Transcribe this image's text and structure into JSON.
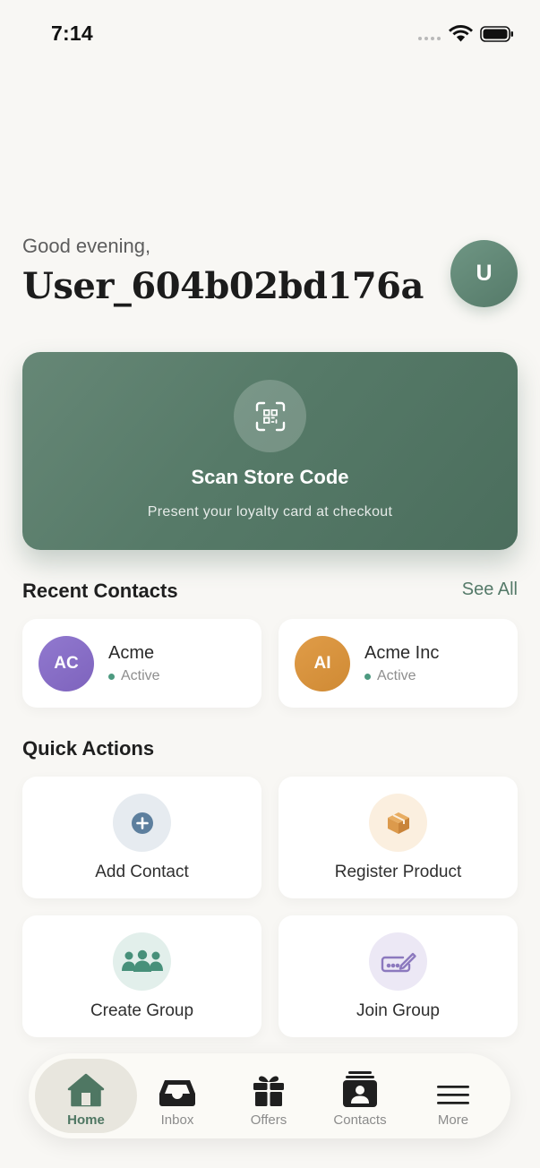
{
  "status_bar": {
    "time": "7:14"
  },
  "header": {
    "greeting": "Good evening,",
    "username": "User_604b02bd176a",
    "avatar_initial": "U"
  },
  "scan_card": {
    "title": "Scan Store Code",
    "subtitle": "Present your loyalty card at checkout",
    "icon": "qr-scan-icon"
  },
  "recent_contacts": {
    "title": "Recent Contacts",
    "see_all": "See All",
    "items": [
      {
        "initials": "AC",
        "name": "Acme",
        "status": "Active",
        "color": "#8c6dc6"
      },
      {
        "initials": "AI",
        "name": "Acme Inc",
        "status": "Active",
        "color": "#d9913a"
      }
    ]
  },
  "quick_actions": {
    "title": "Quick Actions",
    "items": [
      {
        "label": "Add Contact",
        "icon": "plus-circle-icon",
        "bg": "#e6ebf0",
        "color": "#5d7f9e"
      },
      {
        "label": "Register Product",
        "icon": "box-icon",
        "bg": "#fbefdf",
        "color": "#dc9a4c"
      },
      {
        "label": "Create Group",
        "icon": "group-icon",
        "bg": "#e2efeb",
        "color": "#47907a"
      },
      {
        "label": "Join Group",
        "icon": "ticket-pen-icon",
        "bg": "#ece8f5",
        "color": "#8c79be"
      }
    ]
  },
  "tab_bar": {
    "active": "Home",
    "items": [
      {
        "label": "Home",
        "icon": "home-icon"
      },
      {
        "label": "Inbox",
        "icon": "inbox-icon"
      },
      {
        "label": "Offers",
        "icon": "gift-icon"
      },
      {
        "label": "Contacts",
        "icon": "contacts-icon"
      },
      {
        "label": "More",
        "icon": "menu-icon"
      }
    ]
  },
  "colors": {
    "background": "#f8f7f4",
    "accent": "#557a69",
    "text_dark": "#1c1c1c"
  }
}
